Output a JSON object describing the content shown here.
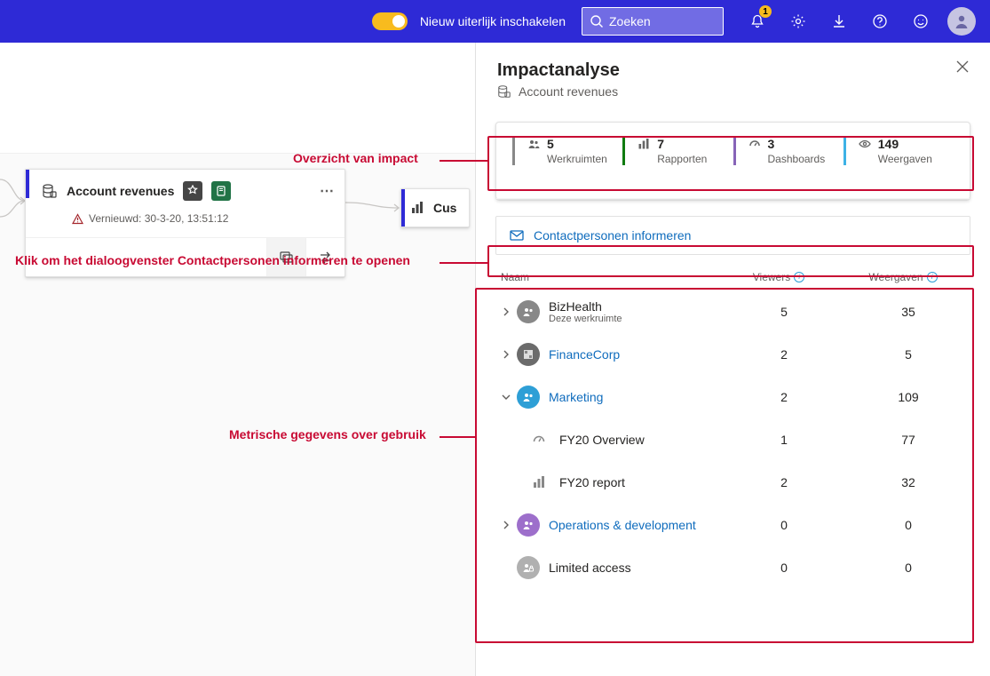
{
  "topbar": {
    "switch_label": "Nieuw uiterlijk inschakelen",
    "search_placeholder": "Zoeken",
    "notification_count": "1"
  },
  "callouts": {
    "overview": "Overzicht van impact",
    "notify": "Klik om het dialoogvenster Contactpersonen informeren te openen",
    "usage": "Metrische gegevens over gebruik"
  },
  "card": {
    "title": "Account revenues",
    "refresh": "Vernieuwd: 30-3-20, 13:51:12"
  },
  "cuscard": {
    "label": "Cus"
  },
  "panel": {
    "title": "Impactanalyse",
    "subtitle": "Account revenues",
    "summary": {
      "ws": {
        "value": "5",
        "label": "Werkruimten"
      },
      "rep": {
        "value": "7",
        "label": "Rapporten"
      },
      "dash": {
        "value": "3",
        "label": "Dashboards"
      },
      "views": {
        "value": "149",
        "label": "Weergaven"
      }
    },
    "notify_label": "Contactpersonen informeren",
    "columns": {
      "name": "Naam",
      "viewers": "Viewers",
      "views": "Weergaven"
    },
    "rows": [
      {
        "name": "BizHealth",
        "sub": "Deze werkruimte",
        "viewers": "5",
        "views": "35"
      },
      {
        "name": "FinanceCorp",
        "viewers": "2",
        "views": "5"
      },
      {
        "name": "Marketing",
        "viewers": "2",
        "views": "109"
      },
      {
        "name": "FY20 Overview",
        "viewers": "1",
        "views": "77"
      },
      {
        "name": "FY20 report",
        "viewers": "2",
        "views": "32"
      },
      {
        "name": "Operations & development",
        "viewers": "0",
        "views": "0"
      },
      {
        "name": "Limited access",
        "viewers": "0",
        "views": "0"
      }
    ]
  }
}
